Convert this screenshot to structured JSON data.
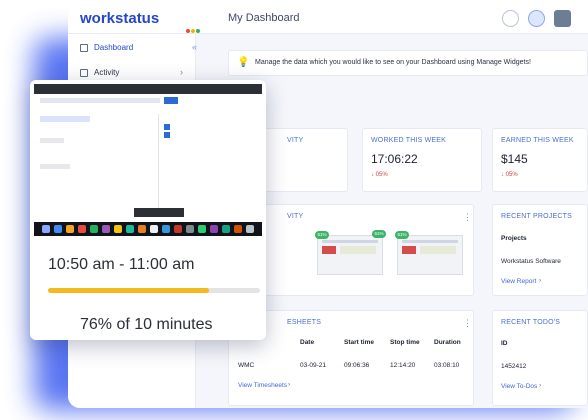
{
  "app": {
    "logo": "workstatus",
    "logo_dot_colors": [
      "#e94b3c",
      "#f5b400",
      "#3cae5a",
      "#2646c8"
    ],
    "page_title": "My Dashboard"
  },
  "sidebar": {
    "items": [
      {
        "label": "Dashboard",
        "icon": "grid-icon"
      },
      {
        "label": "Activity",
        "icon": "activity-icon"
      }
    ]
  },
  "banner": {
    "text": "Manage the data which you would like to see on your Dashboard using Manage Widgets!"
  },
  "stats": [
    {
      "title": "VITY",
      "value": "",
      "delta": ""
    },
    {
      "title": "WORKED THIS WEEK",
      "value": "17:06:22",
      "delta": "↓ 05%"
    },
    {
      "title": "EARNED THIS WEEK",
      "value": "$145",
      "delta": "↓ 05%"
    }
  ],
  "activity_widget": {
    "title": "VITY",
    "thumbnails": [
      {
        "percent": "61%"
      },
      {
        "percent": "61%"
      },
      {
        "percent": "61%"
      }
    ]
  },
  "recent_projects": {
    "title": "RECENT PROJECTS",
    "header": "Projects",
    "rows": [
      "Workstatus Software"
    ],
    "link": "View Report"
  },
  "timesheets": {
    "title": "ESHEETS",
    "columns": [
      "Date",
      "Start time",
      "Stop time",
      "Duration"
    ],
    "rows": [
      {
        "project": "WMC",
        "date": "03-09-21",
        "start": "09:06:36",
        "stop": "12:14:20",
        "duration": "03:08:10"
      }
    ],
    "link": "View Timesheets"
  },
  "recent_todos": {
    "title": "RECENT TODO'S",
    "header": "ID",
    "rows": [
      "1452412"
    ],
    "link": "View To-Dos"
  },
  "overlay": {
    "time_range": "10:50 am - 11:00 am",
    "activity_text": "76% of 10 minutes",
    "activity_fraction": 0.76,
    "progress_color": "#f4b91d"
  }
}
